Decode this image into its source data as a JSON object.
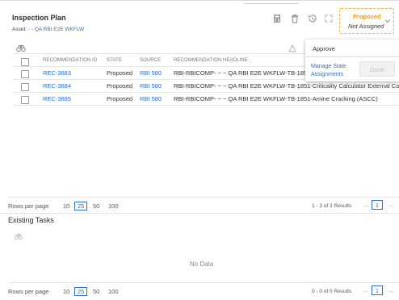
{
  "header": {
    "title": "Inspection Plan",
    "asset_prefix": "Asset:",
    "asset_name": "- - QA RBI E2E WKFLW"
  },
  "state": {
    "current": "Proposed",
    "assignee": "Not Assigned"
  },
  "approve_menu": {
    "approve_label": "Approve",
    "manage_label": "Manage State Assignments",
    "done_label": "Done"
  },
  "recommendations": {
    "columns": [
      "RECOMMENDATION ID",
      "STATE",
      "SOURCE",
      "RECOMMENDATION HEADLINE"
    ],
    "rows": [
      {
        "id": "REC-3683",
        "state": "Proposed",
        "source": "RBI 580",
        "headline": "RBI-RBICOMP- ~ ~ QA RBI E2E WKFLW-TB-1851-Cr"
      },
      {
        "id": "REC-3684",
        "state": "Proposed",
        "source": "RBI 580",
        "headline": "RBI-RBICOMP- ~ ~ QA RBI E2E WKFLW-TB-1851-Criticality Calculator External Corro"
      },
      {
        "id": "REC-3685",
        "state": "Proposed",
        "source": "RBI 580",
        "headline": "RBI-RBICOMP- ~ ~ QA RBI E2E WKFLW-TB-1851-Amine Cracking (ASCC)"
      }
    ],
    "pager": {
      "label": "Rows per page",
      "options": [
        "10",
        "25",
        "50",
        "100"
      ],
      "selected": "25",
      "results": "1 - 3 of 3 Results",
      "page": "1"
    }
  },
  "existing_tasks": {
    "title": "Existing Tasks",
    "empty_text": "No Data",
    "pager": {
      "label": "Rows per page",
      "options": [
        "10",
        "25",
        "50",
        "100"
      ],
      "selected": "25",
      "results": "0 - 0 of 0 Results",
      "page": "1"
    }
  }
}
